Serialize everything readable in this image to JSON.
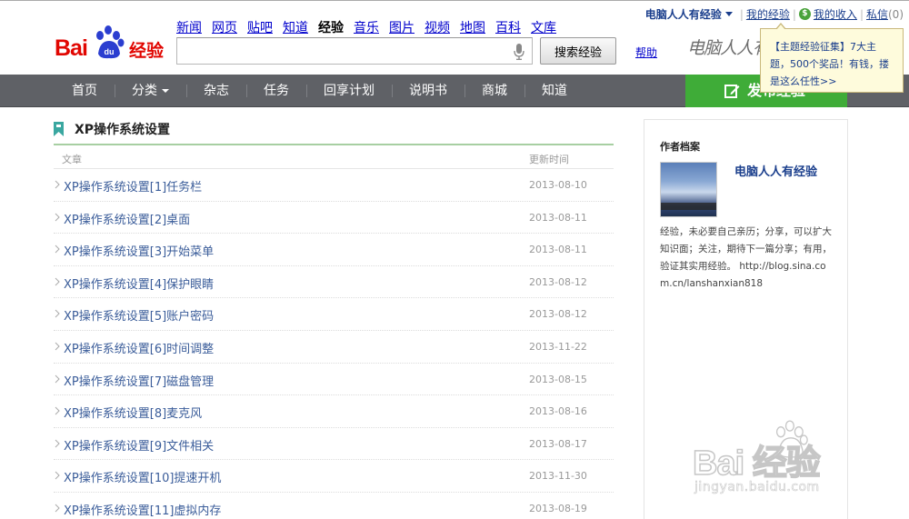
{
  "logo": {
    "text_bai": "Bai",
    "text_jy": "经验"
  },
  "topnav": [
    {
      "label": "新闻"
    },
    {
      "label": "网页"
    },
    {
      "label": "贴吧"
    },
    {
      "label": "知道"
    },
    {
      "label": "经验",
      "active": true
    },
    {
      "label": "音乐"
    },
    {
      "label": "图片"
    },
    {
      "label": "视频"
    },
    {
      "label": "地图"
    },
    {
      "label": "百科"
    },
    {
      "label": "文库"
    }
  ],
  "search": {
    "value": "",
    "button_label": "搜索经验"
  },
  "help_label": "帮助",
  "signature": "电脑人人有",
  "userbar": {
    "username": "电脑人人有经验",
    "my_experience": "我的经验",
    "my_income": "我的收入",
    "messages": "私信",
    "message_count": "(0)"
  },
  "tooltip": {
    "link": "【主题经验征集】",
    "rest": "7大主题，500个奖品！有钱，搂是这么任性>>"
  },
  "mainnav": {
    "items": [
      {
        "label": "首页"
      },
      {
        "label": "分类",
        "dropdown": true
      },
      {
        "label": "杂志"
      },
      {
        "label": "任务"
      },
      {
        "label": "回享计划"
      },
      {
        "label": "说明书"
      },
      {
        "label": "商城"
      },
      {
        "label": "知道"
      }
    ],
    "publish_label": "发布经验"
  },
  "content": {
    "title": "XP操作系统设置",
    "col_article": "文章",
    "col_updated": "更新时间",
    "rows": [
      {
        "title": "XP操作系统设置[1]任务栏",
        "date": "2013-08-10"
      },
      {
        "title": "XP操作系统设置[2]桌面",
        "date": "2013-08-11"
      },
      {
        "title": "XP操作系统设置[3]开始菜单",
        "date": "2013-08-11"
      },
      {
        "title": "XP操作系统设置[4]保护眼睛",
        "date": "2013-08-12"
      },
      {
        "title": "XP操作系统设置[5]账户密码",
        "date": "2013-08-12"
      },
      {
        "title": "XP操作系统设置[6]时间调整",
        "date": "2013-11-22"
      },
      {
        "title": "XP操作系统设置[7]磁盘管理",
        "date": "2013-08-15"
      },
      {
        "title": "XP操作系统设置[8]麦克风",
        "date": "2013-08-16"
      },
      {
        "title": "XP操作系统设置[9]文件相关",
        "date": "2013-08-17"
      },
      {
        "title": "XP操作系统设置[10]提速开机",
        "date": "2013-11-30"
      },
      {
        "title": "XP操作系统设置[11]虚拟内存",
        "date": "2013-08-19"
      }
    ]
  },
  "sidebar": {
    "title": "作者档案",
    "author": "电脑人人有经验",
    "bio": "经验，未必要自己亲历；分享，可以扩大知识面；关注，期待下一篇分享；有用，验证其实用经验。 http://blog.sina.com.cn/lanshanxian818"
  },
  "watermark": {
    "line1": "Bai  经验",
    "line2": "jingyan.baidu.com"
  },
  "colors": {
    "brand_red": "#e10601",
    "nav_bg": "#5f6166",
    "publish_green": "#3fac38",
    "link_blue": "#3b5d9a",
    "tooltip_bg": "#fefbdc"
  }
}
